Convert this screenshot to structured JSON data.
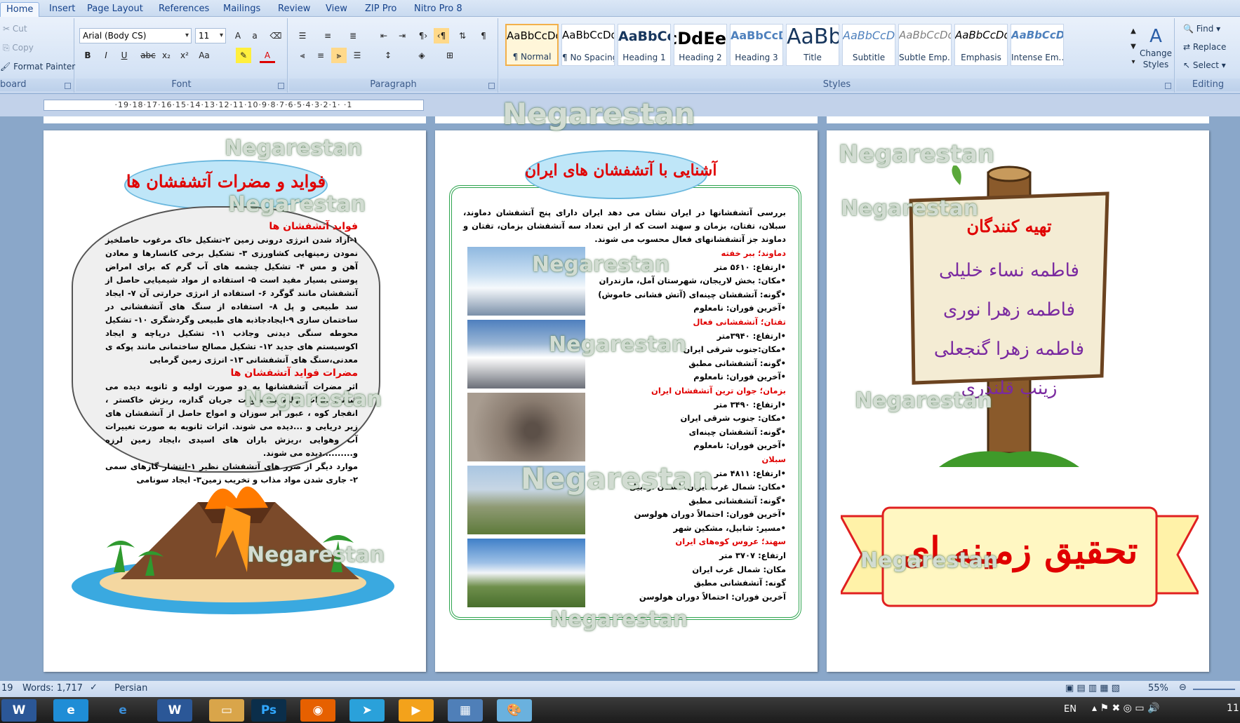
{
  "tabs": [
    "Home",
    "Insert",
    "Page Layout",
    "References",
    "Mailings",
    "Review",
    "View",
    "ZIP Pro",
    "Nitro Pro 8"
  ],
  "clipboard": {
    "cut": "Cut",
    "copy": "Copy",
    "format_painter": "Format Painter",
    "label": "board"
  },
  "font": {
    "name": "Arial (Body CS)",
    "size": "11",
    "label": "Font"
  },
  "paragraph": {
    "label": "Paragraph"
  },
  "styles": {
    "label": "Styles",
    "items": [
      {
        "sample": "AaBbCcDdEe",
        "name": "¶ Normal"
      },
      {
        "sample": "AaBbCcDdEe",
        "name": "¶ No Spacing"
      },
      {
        "sample": "AaBbCcDdEe",
        "name": "Heading 1"
      },
      {
        "sample": "AaBbCcDdEe",
        "name": "Heading 2"
      },
      {
        "sample": "AaBbCcDdEe",
        "name": "Heading 3"
      },
      {
        "sample": "AaBbCcDdEe",
        "name": "Title"
      },
      {
        "sample": "AaBbCcDdEe",
        "name": "Subtitle"
      },
      {
        "sample": "AaBbCcDdEe",
        "name": "Subtle Emp..."
      },
      {
        "sample": "AaBbCcDdEe",
        "name": "Emphasis"
      },
      {
        "sample": "AaBbCcDdEe",
        "name": "Intense Em..."
      }
    ],
    "change_styles": "Change Styles"
  },
  "editing": {
    "find": "Find",
    "replace": "Replace",
    "select": "Select",
    "label": "Editing"
  },
  "ruler": "·19·18·17·16·15·14·13·12·11·10·9·8·7·6·5·4·3·2·1· ·1",
  "page_left": {
    "title": "فواید و مضرات آتشفشان ها",
    "benefits_heading": "فواید آتشفشان ها",
    "benefits_text": "۱-آزاد شدن انرژی درونی زمین ۲-تشکیل خاک مرغوب حاصلخیز نمودن زمینهایی کشاورزی ۳- تشکیل برخی کانسارها و معادن آهن و مس ۴- تشکیل چشمه های آب گرم که برای امراض پوستی بسیار مفید است ۵- استفاده از مواد شیمیایی حاصل از آتشفشان مانند گوگرد ۶- استفاده از انرژی حرارتی آن ۷- ایجاد سد طبیعی و پل ۸- استفاده از سنگ های آتشفشانی در ساختمان سازی ۹-ایجادجاذبه های طبیعی وگردشگری ۱۰- تشکیل محوطه سنگی دیدنی وجاذب ۱۱- تشکیل دریاچه و ایجاد اکوسیستم های جدید ۱۲- تشکیل مصالح ساختمانی مانند پوکه ی معدنی،سنگ های آتشفشانی ۱۳- انرژی زمین گرمایی",
    "harms_heading": "مضرات فواید آتشفشان ها",
    "harms_text": "اثر مضرات آتشفشانها به دو صورت اولیه و ثانویه دیده می شوند. اثرات اولیه به صورت جریان گدازه، ریزش خاکستر ، انفجار کوه ، عبور ابر سوزان و امواج حاصل از آتشفشان های زیر دریایی و ...دیده می شوند. اثرات ثانویه به صورت تغییرات آب وهوایی ،ریزش باران های اسیدی ،ایجاد زمین لرزه و..........دیده می شوند.",
    "extra_text": "موارد دیگر از ضرر های آتشفشان نظیر ۱-انتشار گازهای سمی ۲- جاری شدن مواد مذاب و تخریب زمین۳- ایجاد سونامی"
  },
  "page_middle": {
    "title": "آشنایی با آتشفشان های ایران",
    "intro": "بررسی آتشفشانها در ایران نشان می دهد ایران دارای پنج آتشفشان دماوند، سبلان، تفتان، بزمان و سهند است که از این تعداد سه آتشفشان بزمان، تفتان و دماوند جز آتشفشانهای فعال محسوب می شوند.",
    "volcanoes": [
      {
        "name": "دماوند؛ ببر خفته",
        "lines": [
          "•ارتفاع: ۵۶۱۰ متر",
          "•مکان: بخش لاریجان، شهرستان آمل، مازندران",
          "•گونه: آتشفشان چینه‌ای (آتش فشانی خاموش)",
          "•آخرین فوران: نامعلوم"
        ]
      },
      {
        "name": "تفتان؛ آتشفشانی فعال",
        "lines": [
          "•ارتفاع: ۳۹۴۰متر",
          "•مکان:جنوب شرقی ایران",
          "•گونه: آتشفشانی مطبق",
          "•آخرین فوران: نامعلوم"
        ]
      },
      {
        "name": "بزمان؛ جوان ترین آتشفشان ایران",
        "lines": [
          "•ارتفاع: ۳۴۹۰ متر",
          "•مکان: جنوب شرقی ایران",
          "•گونه: آتشفشان چینه‌ای",
          "•آخرین فوران: نامعلوم"
        ]
      },
      {
        "name": "سبلان",
        "lines": [
          "•ارتفاع: ۴۸۱۱ متر",
          "•مکان: شمال غرب ایران، استان اردبیل",
          "•گونه: آتشفشانی مطبق",
          "•آخرین فوران: احتمالاً دوران هولوسن",
          "•مسیر: شابیل، مشکین شهر"
        ]
      },
      {
        "name": "سهند؛ عروس کوه‌های ایران",
        "lines": [
          "ارتفاع: ۳۷۰۷ متر",
          "مکان: شمال غرب ایران",
          "گونه: آتشفشانی مطبق",
          "آخرین فوران: احتمالاً دوران هولوسن"
        ]
      }
    ]
  },
  "page_right": {
    "prepared_by": "تهیه کنندگان",
    "names": [
      "فاطمه نساء خلیلی",
      "فاطمه زهرا نوری",
      "فاطمه زهرا گنجعلی",
      "زینب قلندری"
    ],
    "banner": "تحقیق زمینه ای"
  },
  "status": {
    "page": "19",
    "words": "Words: 1,717",
    "language": "Persian",
    "zoom": "55%"
  },
  "taskbar": {
    "lang": "EN",
    "clock": "11"
  },
  "watermark": "Negarestan"
}
